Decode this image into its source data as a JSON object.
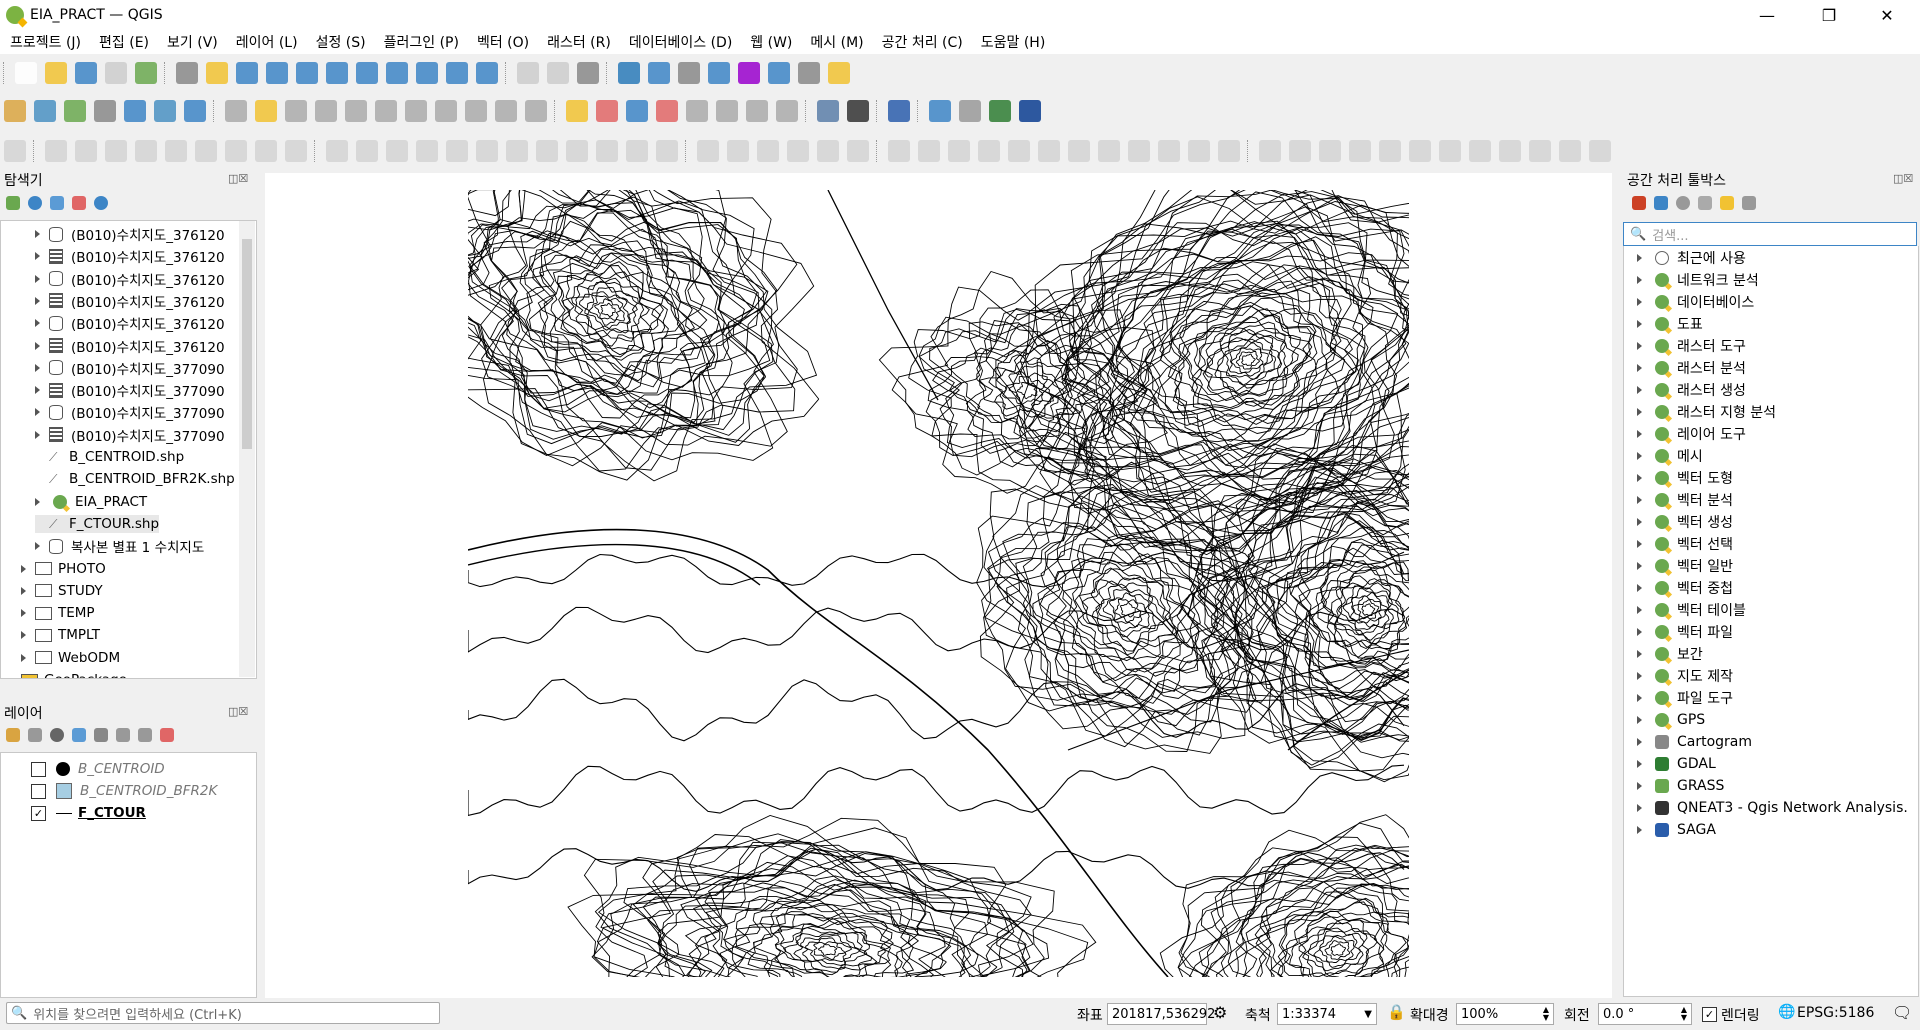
{
  "window": {
    "title": "EIA_PRACT — QGIS"
  },
  "menu": [
    "프로젝트 (J)",
    "편집 (E)",
    "보기 (V)",
    "레이어 (L)",
    "설정 (S)",
    "플러그인 (P)",
    "벡터 (O)",
    "래스터 (R)",
    "데이터베이스 (D)",
    "웹 (W)",
    "메시 (M)",
    "공간 처리 (C)",
    "도움말 (H)"
  ],
  "browser": {
    "title": "탐색기",
    "items": [
      {
        "label": "(B010)수치지도_376120",
        "icon": "database-icon",
        "expand": true
      },
      {
        "label": "(B010)수치지도_376120",
        "icon": "raster-icon",
        "expand": true
      },
      {
        "label": "(B010)수치지도_376120",
        "icon": "database-icon",
        "expand": true
      },
      {
        "label": "(B010)수치지도_376120",
        "icon": "raster-icon",
        "expand": true
      },
      {
        "label": "(B010)수치지도_376120",
        "icon": "database-icon",
        "expand": true
      },
      {
        "label": "(B010)수치지도_376120",
        "icon": "raster-icon",
        "expand": true
      },
      {
        "label": "(B010)수치지도_377090",
        "icon": "database-icon",
        "expand": true
      },
      {
        "label": "(B010)수치지도_377090",
        "icon": "raster-icon",
        "expand": true
      },
      {
        "label": "(B010)수치지도_377090",
        "icon": "database-icon",
        "expand": true
      },
      {
        "label": "(B010)수치지도_377090",
        "icon": "raster-icon",
        "expand": true
      },
      {
        "label": "B_CENTROID.shp",
        "icon": "vector-icon",
        "expand": false
      },
      {
        "label": "B_CENTROID_BFR2K.shp",
        "icon": "vector-icon",
        "expand": false
      },
      {
        "label": "EIA_PRACT",
        "icon": "qgis-project-icon",
        "expand": true
      },
      {
        "label": "F_CTOUR.shp",
        "icon": "vector-icon",
        "expand": false
      },
      {
        "label": "복사본 별표 1 수치지도",
        "icon": "database-icon",
        "expand": true
      }
    ],
    "folders": [
      "PHOTO",
      "STUDY",
      "TEMP",
      "TMPLT",
      "WebODM"
    ],
    "geopackage": "GeoPackage"
  },
  "layers": {
    "title": "레이어",
    "items": [
      {
        "label": "B_CENTROID",
        "checked": false
      },
      {
        "label": "B_CENTROID_BFR2K",
        "checked": false
      },
      {
        "label": "F_CTOUR",
        "checked": true
      }
    ]
  },
  "processing": {
    "title": "공간 처리 툴박스",
    "search_placeholder": "검색...",
    "groups": [
      "최근에 사용",
      "네트워크 분석",
      "데이터베이스",
      "도표",
      "래스터 도구",
      "래스터 분석",
      "래스터 생성",
      "래스터 지형 분석",
      "레이어 도구",
      "메시",
      "벡터 도형",
      "벡터 분석",
      "벡터 생성",
      "벡터 선택",
      "벡터 일반",
      "벡터 중첩",
      "벡터 테이블",
      "벡터 파일",
      "보간",
      "지도 제작",
      "파일 도구",
      "GPS",
      "Cartogram",
      "GDAL",
      "GRASS",
      "QNEAT3 - Qgis Network Analysis...",
      "SAGA"
    ]
  },
  "status": {
    "locator_placeholder": "위치를 찾으려면 입력하세요 (Ctrl+K)",
    "coord_label": "좌표",
    "coord_value": "201817,536292",
    "scale_label": "축척",
    "scale_value": "1:33374",
    "magnifier_label": "확대경",
    "magnifier_value": "100%",
    "rotation_label": "회전",
    "rotation_value": "0.0 °",
    "render_label": "렌더링",
    "crs": "EPSG:5186"
  }
}
